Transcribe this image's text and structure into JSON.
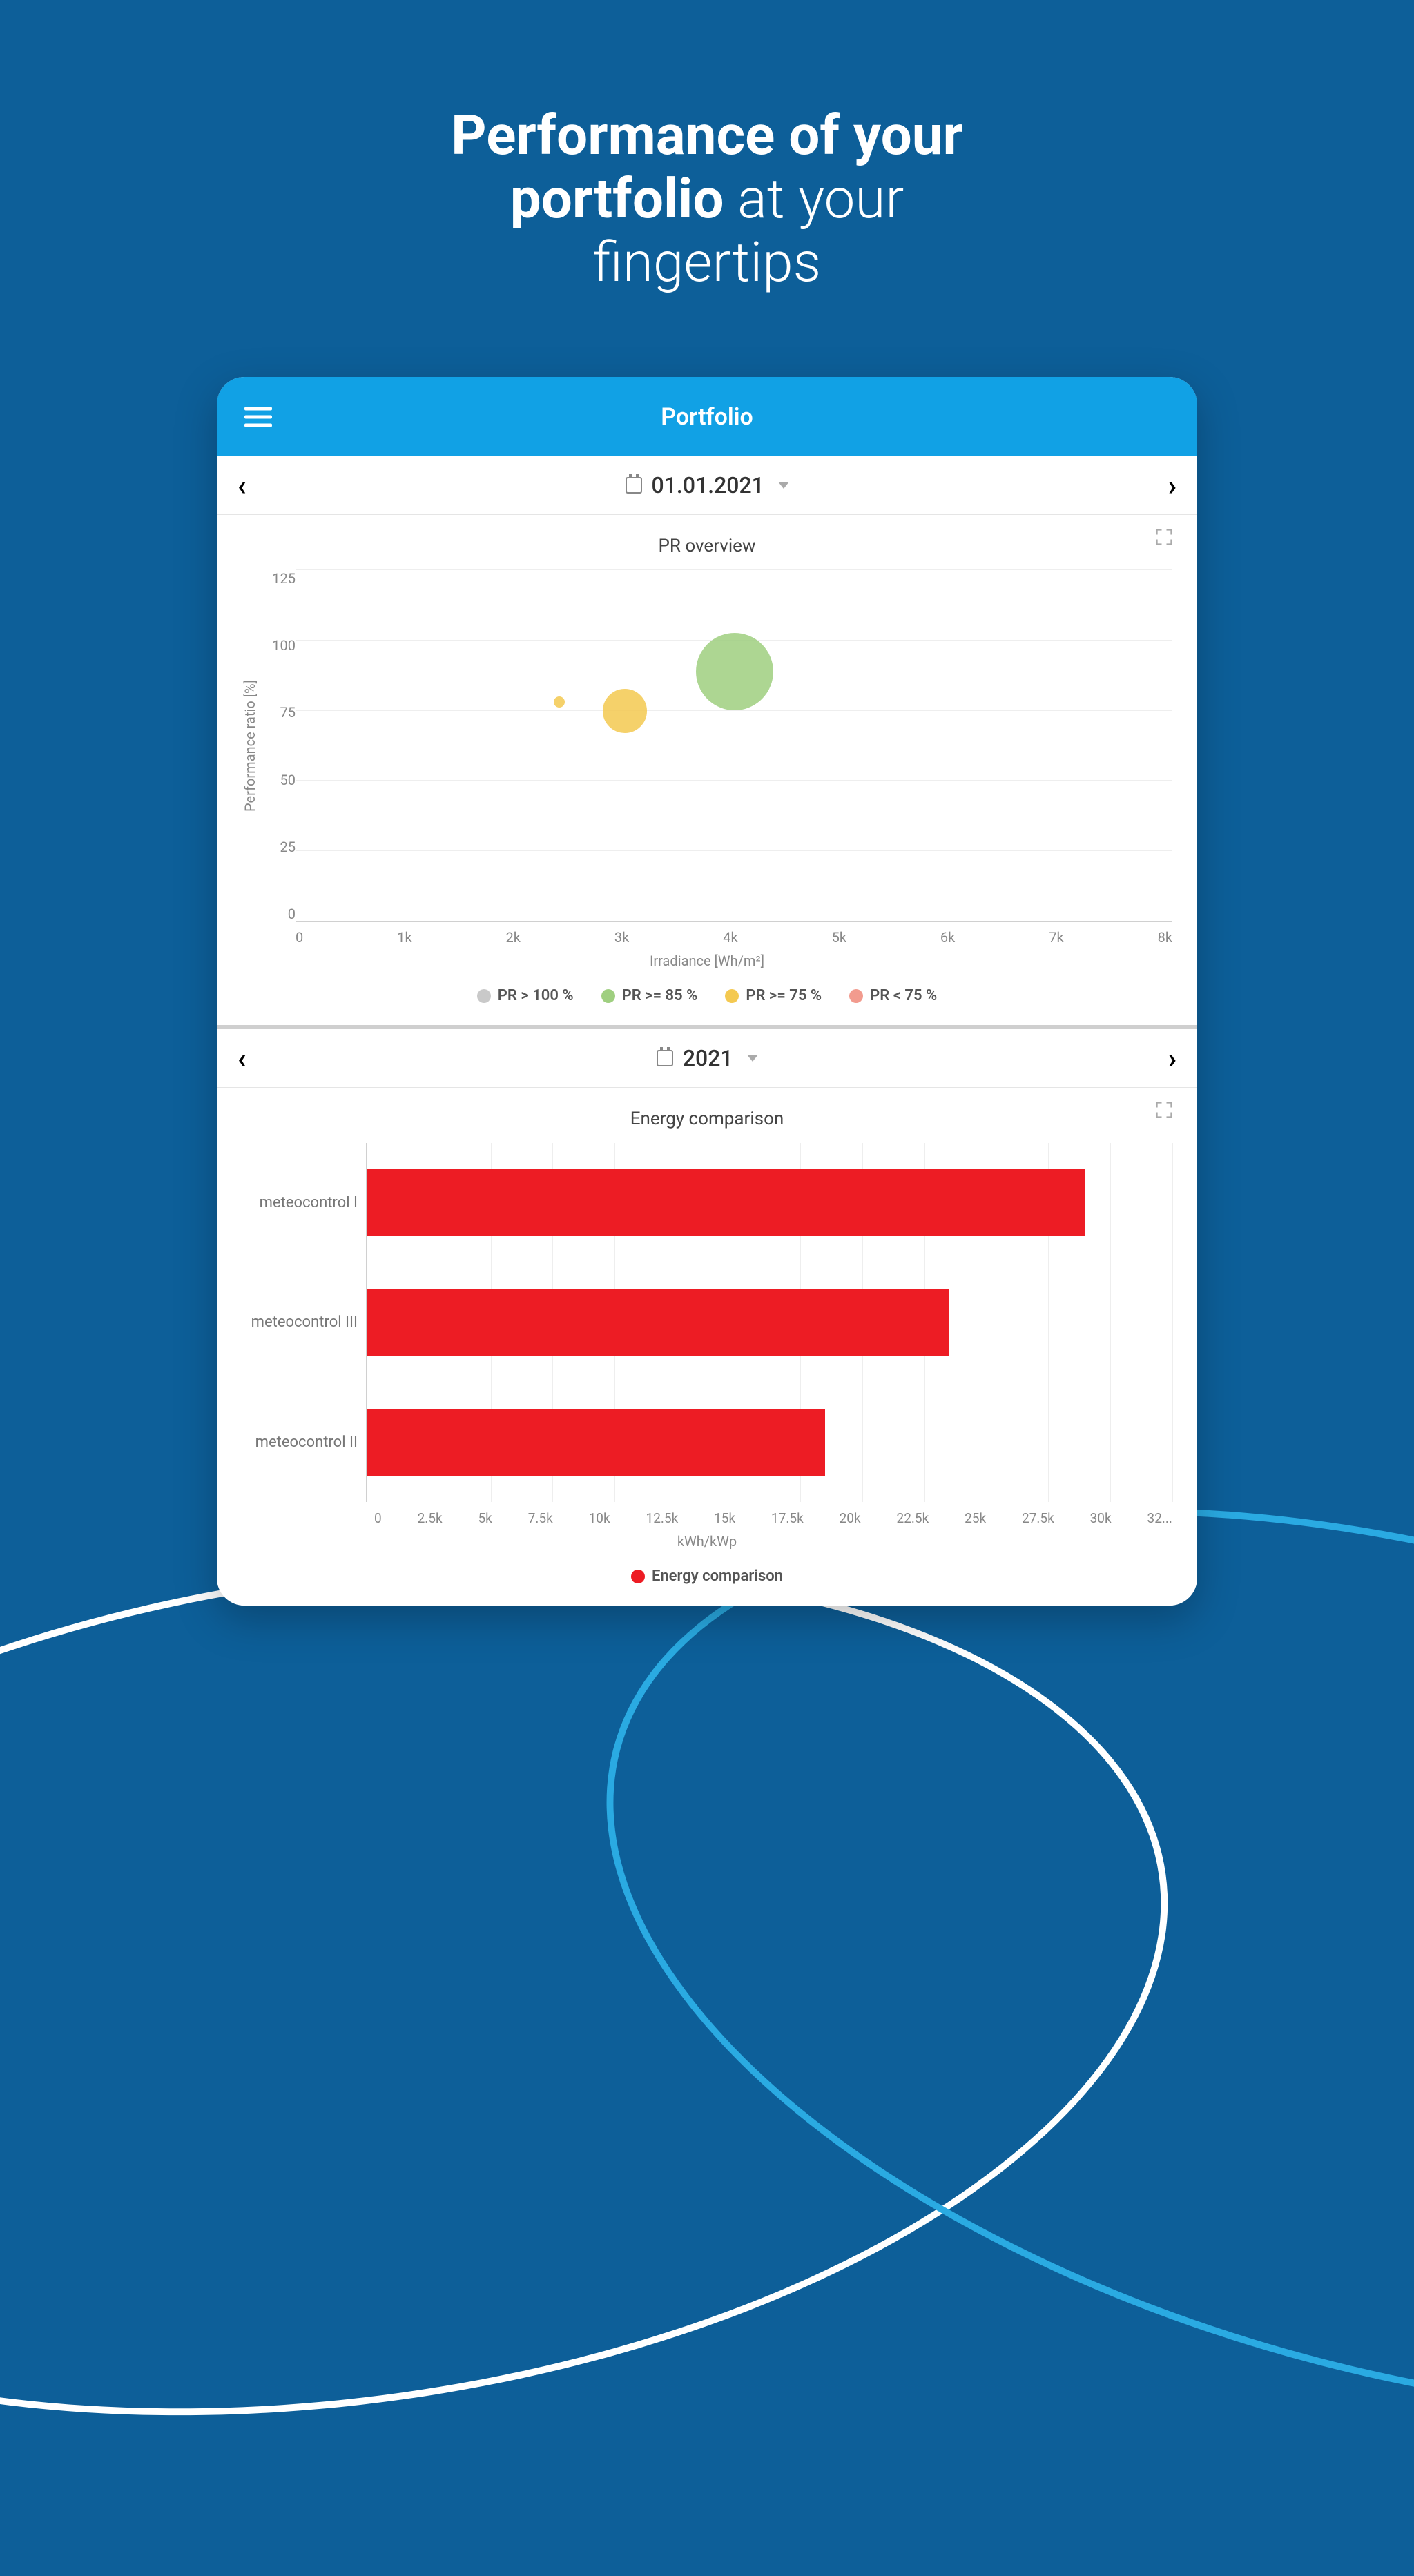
{
  "hero": {
    "line1_bold": "Performance of your",
    "line2_bold": "portfolio",
    "line2_light": " at your",
    "line3_light": "fingertips"
  },
  "app": {
    "title": "Portfolio"
  },
  "scatter_panel": {
    "date": "01.01.2021",
    "title": "PR overview",
    "y_label": "Performance ratio [%]",
    "x_label": "Irradiance [Wh/m²]",
    "y_ticks": [
      "125",
      "100",
      "75",
      "50",
      "25",
      "0"
    ],
    "x_ticks": [
      "0",
      "1k",
      "2k",
      "3k",
      "4k",
      "5k",
      "6k",
      "7k",
      "8k"
    ],
    "legend": [
      {
        "label": "PR > 100 %",
        "color": "#c9c9c9"
      },
      {
        "label": "PR >= 85 %",
        "color": "#9fcf80"
      },
      {
        "label": "PR >= 75 %",
        "color": "#f4c951"
      },
      {
        "label": "PR < 75 %",
        "color": "#f29b8e"
      }
    ]
  },
  "bar_panel": {
    "date": "2021",
    "title": "Energy comparison",
    "x_label": "kWh/kWp",
    "categories": [
      "meteocontrol I",
      "meteocontrol III",
      "meteocontrol II"
    ],
    "x_ticks": [
      "0",
      "2.5k",
      "5k",
      "7.5k",
      "10k",
      "12.5k",
      "15k",
      "17.5k",
      "20k",
      "22.5k",
      "25k",
      "27.5k",
      "30k",
      "32..."
    ],
    "legend_label": "Energy comparison",
    "legend_color": "#ed1c24"
  },
  "chart_data": [
    {
      "type": "scatter",
      "title": "PR overview",
      "xlabel": "Irradiance [Wh/m²]",
      "ylabel": "Performance ratio [%]",
      "xlim": [
        0,
        8000
      ],
      "ylim": [
        0,
        125
      ],
      "series": [
        {
          "name": "PR >= 75 %",
          "points": [
            {
              "x": 2400,
              "y": 78,
              "size": 10
            },
            {
              "x": 3000,
              "y": 75,
              "size": 40
            }
          ],
          "color": "#f4c951"
        },
        {
          "name": "PR >= 85 %",
          "points": [
            {
              "x": 4000,
              "y": 89,
              "size": 70
            }
          ],
          "color": "#9fcf80"
        }
      ]
    },
    {
      "type": "bar",
      "orientation": "horizontal",
      "title": "Energy comparison",
      "xlabel": "kWh/kWp",
      "xlim": [
        0,
        32500
      ],
      "categories": [
        "meteocontrol I",
        "meteocontrol III",
        "meteocontrol II"
      ],
      "series": [
        {
          "name": "Energy comparison",
          "values": [
            29000,
            23500,
            18500
          ],
          "color": "#ed1c24"
        }
      ]
    }
  ]
}
